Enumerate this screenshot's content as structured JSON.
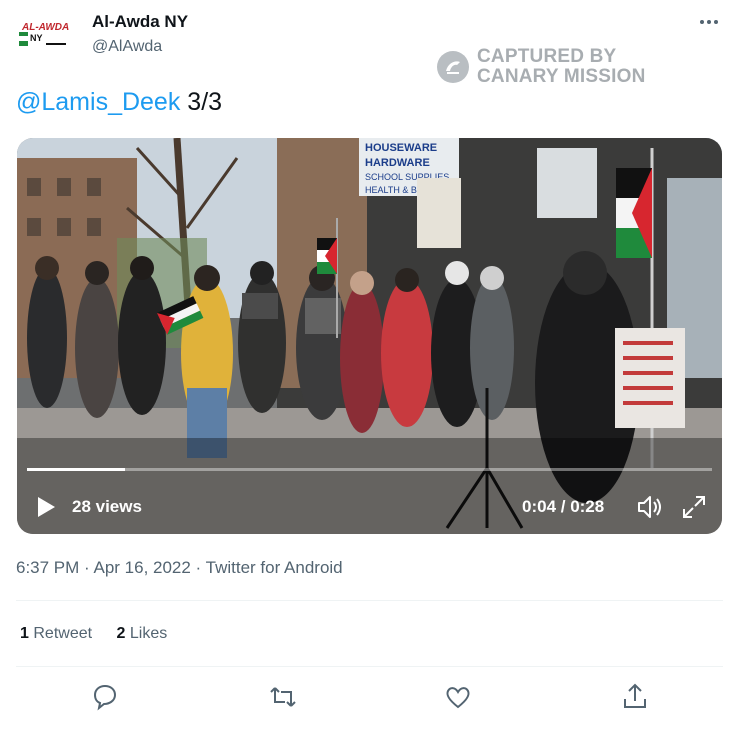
{
  "account": {
    "avatar_logo_text": "AL-AWDA NY",
    "display_name": "Al-Awda NY",
    "handle": "@AlAwda"
  },
  "watermark": {
    "line1": "CAPTURED BY",
    "line2": "CANARY MISSION"
  },
  "tweet": {
    "mention": "@Lamis_Deek",
    "text": "3/3"
  },
  "video": {
    "sign_text_storefront": "HOUSEWARE HARDWARE SCHOOL SUPPLIES HEALTH & BEAUTY",
    "views_label": "28 views",
    "time_label": "0:04 / 0:28",
    "progress": 0.143
  },
  "meta": {
    "timestamp": "6:37 PM · Apr 16, 2022 · Twitter for Android"
  },
  "stats": {
    "retweets_count": "1",
    "retweets_label": "Retweet",
    "likes_count": "2",
    "likes_label": "Likes"
  },
  "icons": {
    "more": "more-horizontal-icon",
    "play": "play-icon",
    "volume": "volume-icon",
    "expand": "expand-icon",
    "reply": "reply-icon",
    "retweet": "retweet-icon",
    "like": "heart-icon",
    "share": "share-icon"
  },
  "colors": {
    "accent": "#1d9bf0",
    "text_primary": "#0f1419",
    "text_secondary": "#536471",
    "flag_red": "#d7262f",
    "flag_green": "#1f8a3c"
  }
}
